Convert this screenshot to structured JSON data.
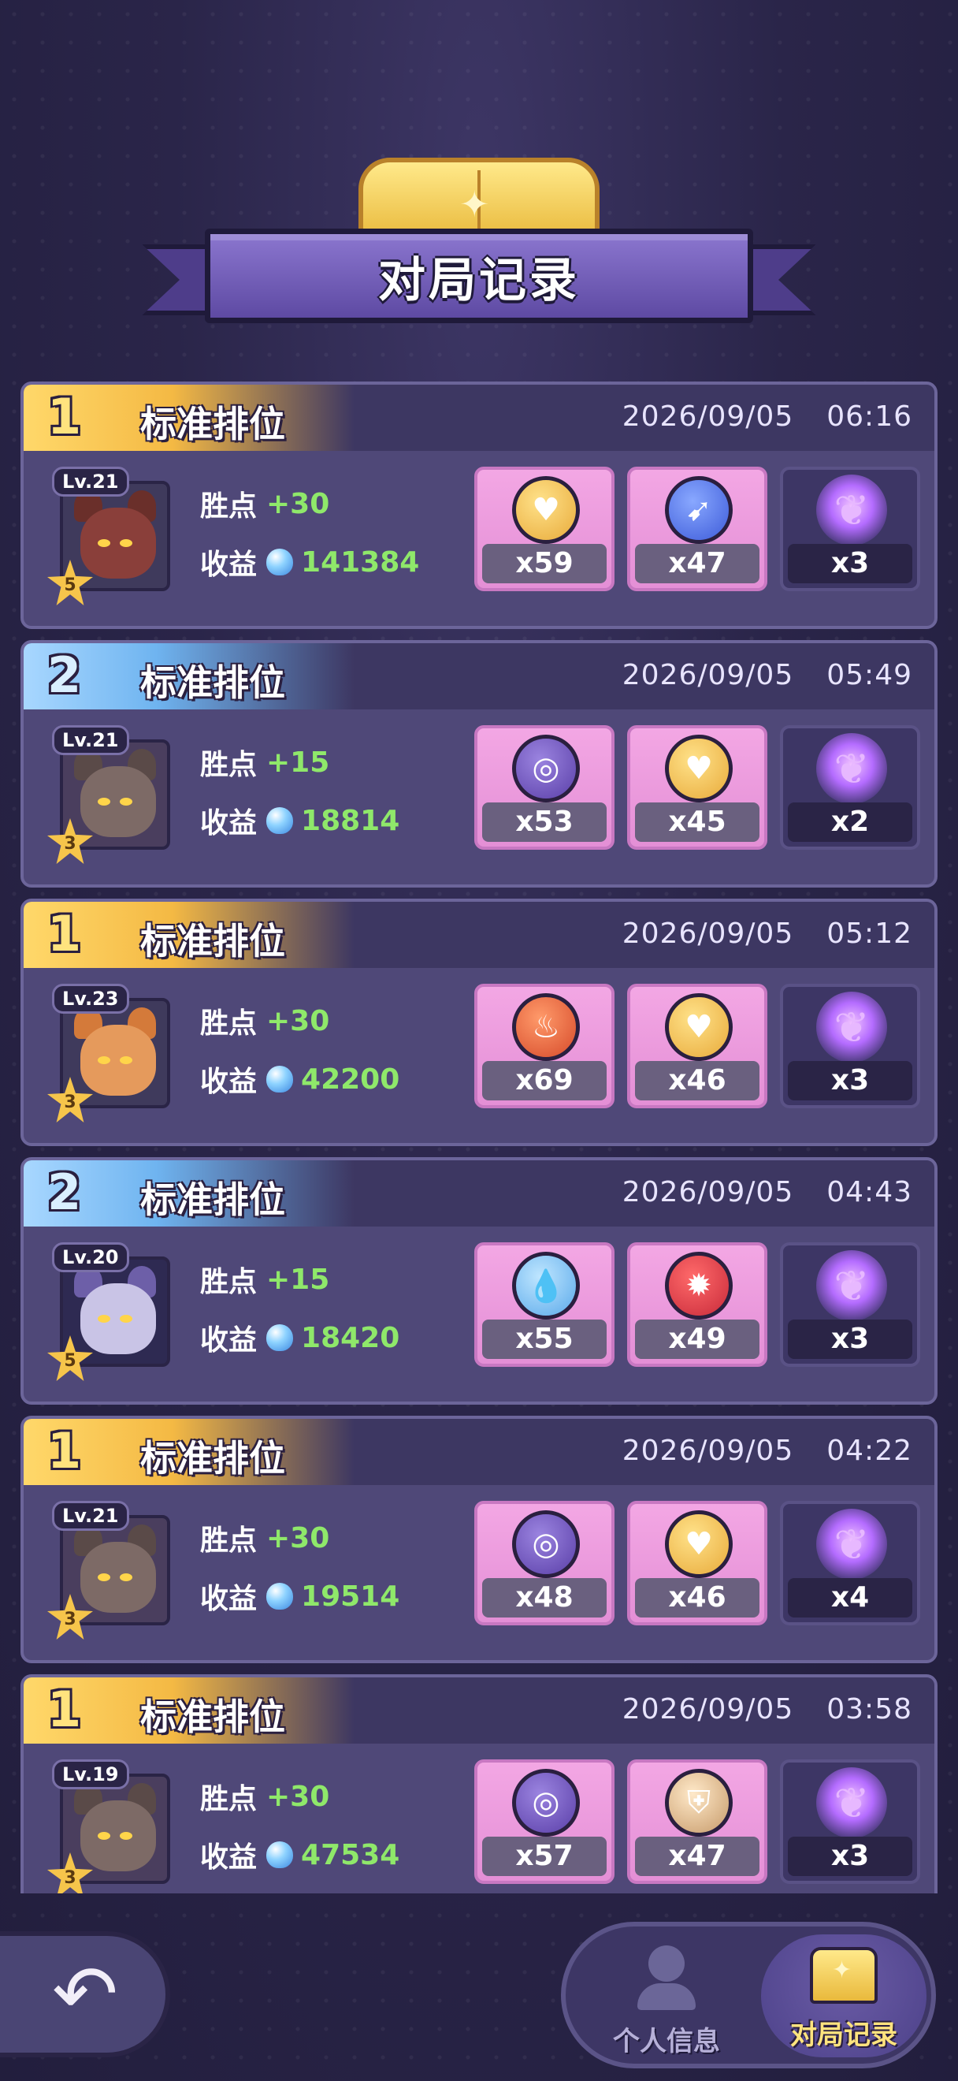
{
  "header": {
    "title": "对局记录"
  },
  "records": [
    {
      "rank": "1",
      "rank_style": "gold",
      "mode": "标准排位",
      "date": "2026/09/05",
      "time": "06:16",
      "level": "Lv.21",
      "stars": "5",
      "points_label": "胜点",
      "points": "+30",
      "income_label": "收益",
      "income": "141384",
      "avatar_colors": {
        "face": "#8a3f3a",
        "ear": "#6a2f2a",
        "bg": "#3f3a5c"
      },
      "items": [
        {
          "icon": "heart-coin-icon",
          "glyph": "♥",
          "style": "heart",
          "qty": "x59"
        },
        {
          "icon": "wing-coin-icon",
          "glyph": "➹",
          "style": "wing",
          "qty": "x47"
        }
      ],
      "wisp_qty": "x3"
    },
    {
      "rank": "2",
      "rank_style": "blue",
      "mode": "标准排位",
      "date": "2026/09/05",
      "time": "05:49",
      "level": "Lv.21",
      "stars": "3",
      "points_label": "胜点",
      "points": "+15",
      "income_label": "收益",
      "income": "18814",
      "avatar_colors": {
        "face": "#7d6a66",
        "ear": "#5a4a48",
        "bg": "#4a3e5e"
      },
      "items": [
        {
          "icon": "swirl-coin-icon",
          "glyph": "◎",
          "style": "swirl",
          "qty": "x53"
        },
        {
          "icon": "heart-coin-icon",
          "glyph": "♥",
          "style": "heart",
          "qty": "x45"
        }
      ],
      "wisp_qty": "x2"
    },
    {
      "rank": "1",
      "rank_style": "gold",
      "mode": "标准排位",
      "date": "2026/09/05",
      "time": "05:12",
      "level": "Lv.23",
      "stars": "3",
      "points_label": "胜点",
      "points": "+30",
      "income_label": "收益",
      "income": "42200",
      "avatar_colors": {
        "face": "#e59a5c",
        "ear": "#d47a3a",
        "bg": "#3f3a5c"
      },
      "items": [
        {
          "icon": "flame-coin-icon",
          "glyph": "♨",
          "style": "flame",
          "qty": "x69"
        },
        {
          "icon": "heart-coin-icon",
          "glyph": "♥",
          "style": "heart",
          "qty": "x46"
        }
      ],
      "wisp_qty": "x3"
    },
    {
      "rank": "2",
      "rank_style": "blue",
      "mode": "标准排位",
      "date": "2026/09/05",
      "time": "04:43",
      "level": "Lv.20",
      "stars": "5",
      "points_label": "胜点",
      "points": "+15",
      "income_label": "收益",
      "income": "18420",
      "avatar_colors": {
        "face": "#c9c4e6",
        "ear": "#6d5fa8",
        "bg": "#2e2a52"
      },
      "items": [
        {
          "icon": "drop-coin-icon",
          "glyph": "💧",
          "style": "drop",
          "qty": "x55"
        },
        {
          "icon": "burst-coin-icon",
          "glyph": "✹",
          "style": "burst",
          "qty": "x49"
        }
      ],
      "wisp_qty": "x3"
    },
    {
      "rank": "1",
      "rank_style": "gold",
      "mode": "标准排位",
      "date": "2026/09/05",
      "time": "04:22",
      "level": "Lv.21",
      "stars": "3",
      "points_label": "胜点",
      "points": "+30",
      "income_label": "收益",
      "income": "19514",
      "avatar_colors": {
        "face": "#7d6a66",
        "ear": "#5a4a48",
        "bg": "#4a3e5e"
      },
      "items": [
        {
          "icon": "swirl-coin-icon",
          "glyph": "◎",
          "style": "swirl",
          "qty": "x48"
        },
        {
          "icon": "heart-coin-icon",
          "glyph": "♥",
          "style": "heart",
          "qty": "x46"
        }
      ],
      "wisp_qty": "x4"
    },
    {
      "rank": "1",
      "rank_style": "gold",
      "mode": "标准排位",
      "date": "2026/09/05",
      "time": "03:58",
      "level": "Lv.19",
      "stars": "3",
      "points_label": "胜点",
      "points": "+30",
      "income_label": "收益",
      "income": "47534",
      "avatar_colors": {
        "face": "#7d6a66",
        "ear": "#5a4a48",
        "bg": "#4a3e5e"
      },
      "items": [
        {
          "icon": "swirl-coin-icon",
          "glyph": "◎",
          "style": "swirl",
          "qty": "x57"
        },
        {
          "icon": "shield-coin-icon",
          "glyph": "⛨",
          "style": "shield",
          "qty": "x47"
        }
      ],
      "wisp_qty": "x3"
    }
  ],
  "bottom_nav": {
    "back_icon": "back-arrow-icon",
    "profile_label": "个人信息",
    "records_label": "对局记录"
  }
}
